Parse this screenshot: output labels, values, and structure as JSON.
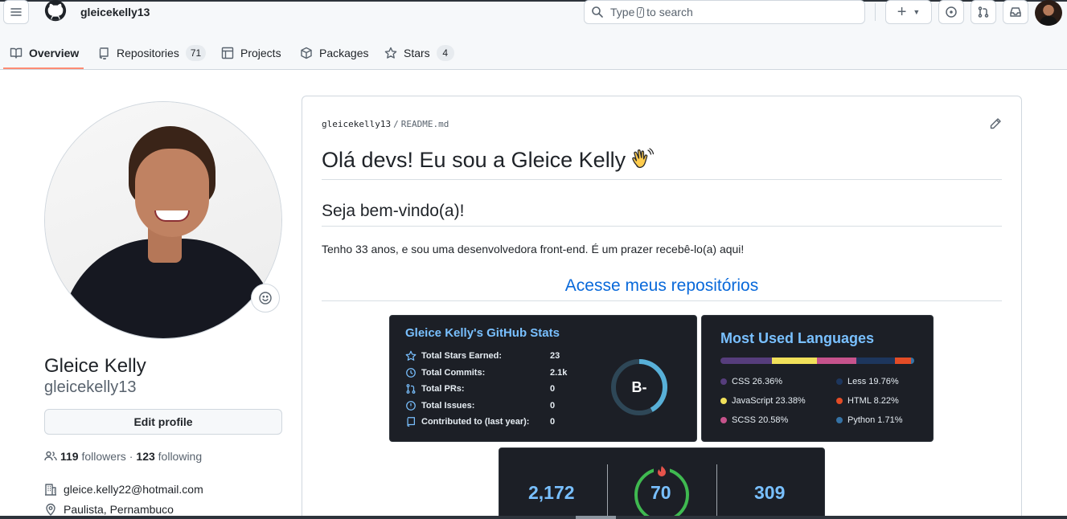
{
  "header": {
    "username": "gleicekelly13",
    "search_prefix": "Type",
    "search_key": "/",
    "search_suffix": "to search"
  },
  "tabs": [
    {
      "label": "Overview",
      "icon": "book-icon"
    },
    {
      "label": "Repositories",
      "count": "71",
      "icon": "repo-icon"
    },
    {
      "label": "Projects",
      "icon": "table-icon"
    },
    {
      "label": "Packages",
      "icon": "package-icon"
    },
    {
      "label": "Stars",
      "count": "4",
      "icon": "star-icon"
    }
  ],
  "profile": {
    "name": "Gleice Kelly",
    "login": "gleicekelly13",
    "edit_label": "Edit profile",
    "followers_count": "119",
    "followers_label": "followers",
    "dot": "·",
    "following_count": "123",
    "following_label": "following",
    "email": "gleice.kelly22@hotmail.com",
    "location": "Paulista, Pernambuco"
  },
  "readme": {
    "owner": "gleicekelly13",
    "slash": "/",
    "file": "README.md",
    "title": "Olá devs! Eu sou a Gleice Kelly",
    "welcome": "Seja bem-vindo(a)!",
    "intro": "Tenho 33 anos, e sou uma desenvolvedora front-end. É um prazer recebê-lo(a) aqui!",
    "repos_link": "Acesse meus repositórios"
  },
  "github_stats": {
    "title": "Gleice Kelly's GitHub Stats",
    "rows": [
      {
        "label": "Total Stars Earned:",
        "value": "23"
      },
      {
        "label": "Total Commits:",
        "value": "2.1k"
      },
      {
        "label": "Total PRs:",
        "value": "0"
      },
      {
        "label": "Total Issues:",
        "value": "0"
      },
      {
        "label": "Contributed to (last year):",
        "value": "0"
      }
    ],
    "rank": "B-",
    "rank_progress": 0.42
  },
  "languages": {
    "title": "Most Used Languages",
    "items": [
      {
        "name": "CSS",
        "pct": 26.36,
        "label": "CSS 26.36%",
        "color": "#563d7c"
      },
      {
        "name": "JavaScript",
        "pct": 23.38,
        "label": "JavaScript 23.38%",
        "color": "#f1e05a"
      },
      {
        "name": "SCSS",
        "pct": 20.58,
        "label": "SCSS 20.58%",
        "color": "#c6538c"
      },
      {
        "name": "Less",
        "pct": 19.76,
        "label": "Less 19.76%",
        "color": "#1d365d"
      },
      {
        "name": "HTML",
        "pct": 8.22,
        "label": "HTML 8.22%",
        "color": "#e34c26"
      },
      {
        "name": "Python",
        "pct": 1.71,
        "label": "Python 1.71%",
        "color": "#3572a5"
      }
    ]
  },
  "streak": {
    "total": "2,172",
    "current": "70",
    "longest": "309"
  },
  "colors": {
    "accent": "#0969da",
    "tab_underline": "#fd8c73",
    "card_bg": "#1c1f26",
    "card_title": "#79c0ff",
    "streak_ring": "#3fb950"
  }
}
